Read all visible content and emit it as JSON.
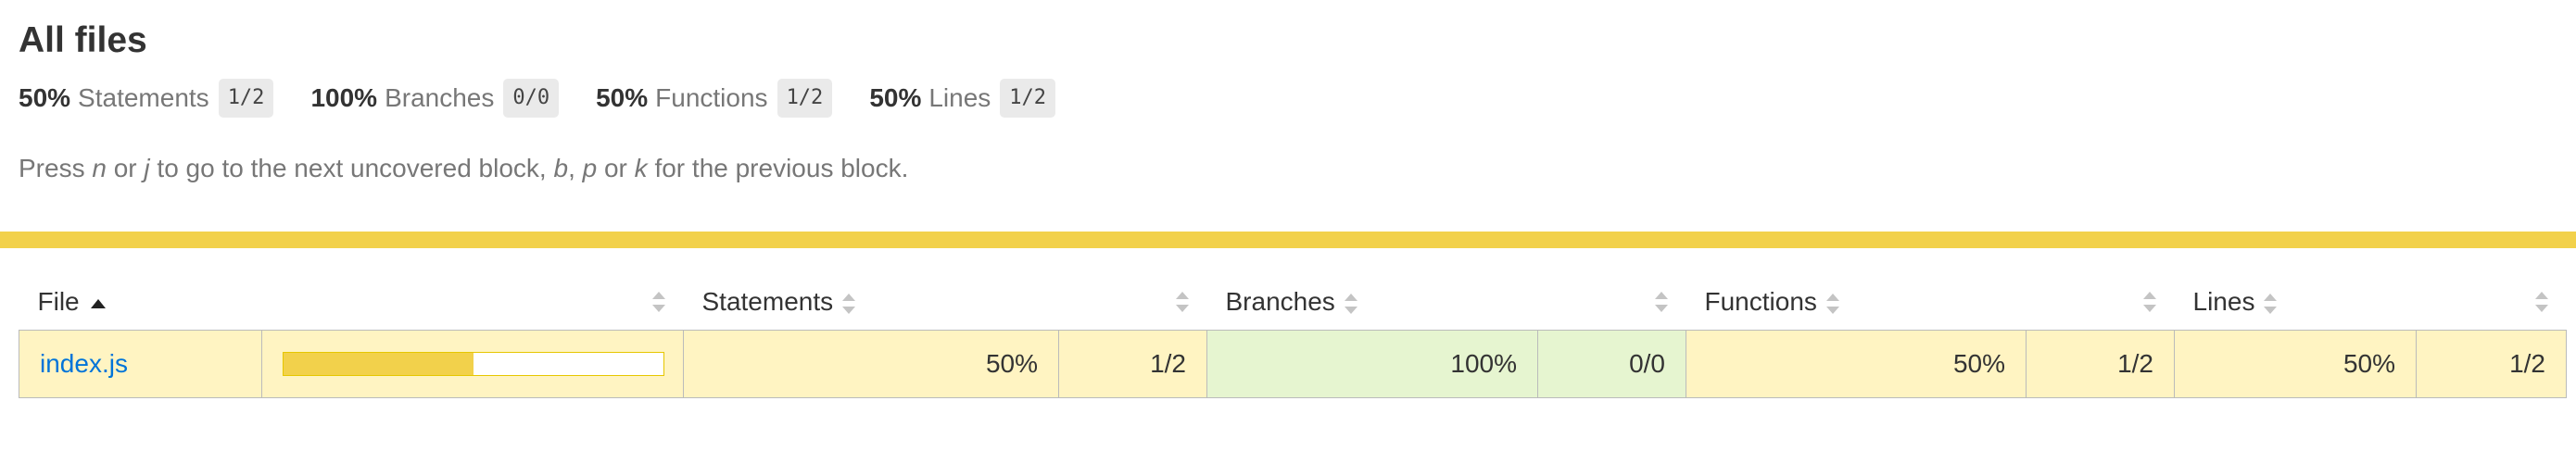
{
  "header": {
    "title": "All files"
  },
  "summary": {
    "statements": {
      "pct": "50%",
      "label": "Statements",
      "fraction": "1/2"
    },
    "branches": {
      "pct": "100%",
      "label": "Branches",
      "fraction": "0/0"
    },
    "functions": {
      "pct": "50%",
      "label": "Functions",
      "fraction": "1/2"
    },
    "lines": {
      "pct": "50%",
      "label": "Lines",
      "fraction": "1/2"
    }
  },
  "hint": {
    "press": "Press",
    "n": "n",
    "or1": "or",
    "j": "j",
    "middle": "to go to the next uncovered block,",
    "b": "b",
    "comma": ",",
    "p": "p",
    "or2": "or",
    "k": "k",
    "end": "for the previous block."
  },
  "colors": {
    "status_bar": "#f2d14b",
    "medium_bg": "#fff4c2",
    "high_bg": "#e6f5d0",
    "link": "#0074d9"
  },
  "table": {
    "headers": {
      "file": "File",
      "statements": "Statements",
      "branches": "Branches",
      "functions": "Functions",
      "lines": "Lines"
    },
    "rows": [
      {
        "file": "index.js",
        "coverage_fraction": 0.5,
        "statements_pct": "50%",
        "statements_frac": "1/2",
        "branches_pct": "100%",
        "branches_frac": "0/0",
        "functions_pct": "50%",
        "functions_frac": "1/2",
        "lines_pct": "50%",
        "lines_frac": "1/2"
      }
    ]
  }
}
